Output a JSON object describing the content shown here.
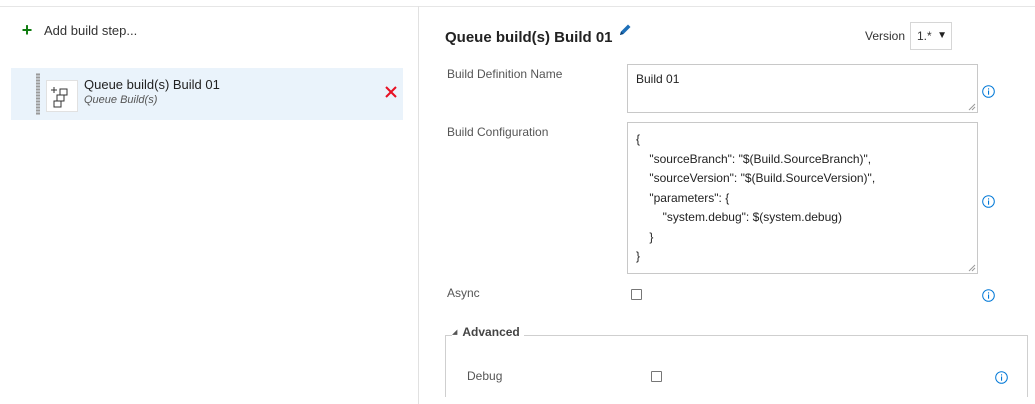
{
  "left_pane": {
    "add_step_icon": "plus-icon",
    "add_step_label": "Add build step...",
    "tasks": [
      {
        "title": "Queue build(s) Build 01",
        "subtitle": "Queue Build(s)",
        "icon": "queue-build-icon",
        "remove_icon": "close-icon"
      }
    ]
  },
  "details": {
    "title": "Queue build(s) Build 01",
    "edit_icon": "pencil-icon",
    "version": {
      "label": "Version",
      "selected": "1.*"
    },
    "fields": {
      "build_definition_name": {
        "label": "Build Definition Name",
        "value": "Build 01"
      },
      "build_configuration": {
        "label": "Build Configuration",
        "value": "{\n    \"sourceBranch\": \"$(Build.SourceBranch)\",\n    \"sourceVersion\": \"$(Build.SourceVersion)\",\n    \"parameters\": {\n        \"system.debug\": $(system.debug)\n    }\n}"
      },
      "async": {
        "label": "Async",
        "checked": false
      }
    },
    "advanced": {
      "label": "Advanced",
      "debug": {
        "label": "Debug",
        "checked": false
      }
    },
    "info_icon": "info-icon"
  },
  "colors": {
    "accent_green": "#107c10",
    "remove_red": "#e81123",
    "info_blue": "#0078d7",
    "selected_bg": "#eaf3fb"
  }
}
